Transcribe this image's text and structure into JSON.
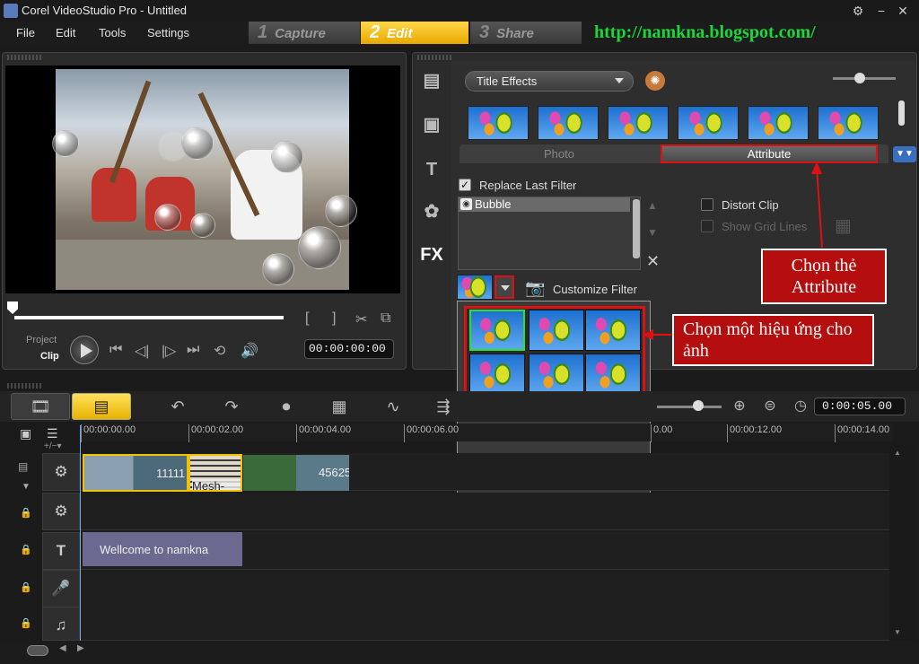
{
  "app": {
    "title": "Corel VideoStudio Pro - Untitled"
  },
  "window_controls": {
    "settings": "⚙",
    "minimize": "−",
    "close": "✕"
  },
  "menu": {
    "items": [
      "File",
      "Edit",
      "Tools",
      "Settings"
    ]
  },
  "steps": [
    {
      "num": "1",
      "label": "Capture"
    },
    {
      "num": "2",
      "label": "Edit"
    },
    {
      "num": "3",
      "label": "Share"
    }
  ],
  "blog_url": "http://namkna.blogspot.com/",
  "preview": {
    "mode_project": "Project",
    "mode_clip": "Clip",
    "timecode": "00:00:00:00"
  },
  "library": {
    "category": "Title Effects",
    "tabs": {
      "photo": "Photo",
      "attribute": "Attribute"
    },
    "replace_last_filter": "Replace Last Filter",
    "filter_item": "Bubble",
    "distort_clip": "Distort Clip",
    "show_grid_lines": "Show Grid Lines",
    "customize_filter": "Customize Filter",
    "side_fx": "FX"
  },
  "callouts": {
    "attribute": "Chọn thẻ Attribute",
    "effect": "Chọn một hiệu ứng cho ảnh"
  },
  "timeline": {
    "duration": "0:00:05.00",
    "ticks": [
      "00:00:00.00",
      "00:00:02.00",
      "00:00:04.00",
      "00:00:06.00",
      "0.00",
      "00:00:12.00",
      "00:00:14.00"
    ],
    "clips": [
      {
        "label": "11111"
      },
      {
        "label": "Mesh-Slic"
      },
      {
        "label": "45625"
      }
    ],
    "title_clip": "Wellcome to namkna"
  },
  "colors": {
    "accent_yellow": "#f2c200",
    "highlight_red": "#d11111",
    "url_green": "#1cd63a"
  }
}
